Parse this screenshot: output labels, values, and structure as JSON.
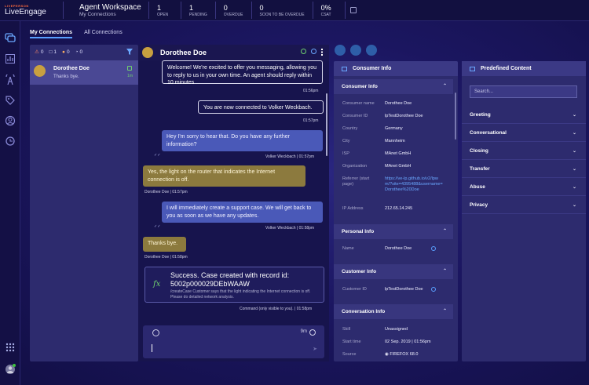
{
  "brand": {
    "small": "LIVEPERSON",
    "name": "LiveEngage"
  },
  "workspace": {
    "title": "Agent Workspace",
    "subtitle": "My Connections"
  },
  "stats": [
    {
      "value": "1",
      "label": "OPEN"
    },
    {
      "value": "1",
      "label": "PENDING"
    },
    {
      "value": "0",
      "label": "OVERDUE"
    },
    {
      "value": "0",
      "label": "SOON TO BE OVERDUE"
    },
    {
      "value": "0%",
      "label": "CSAT"
    }
  ],
  "tabs": {
    "active": "My Connections",
    "other": "All Connections"
  },
  "counts": [
    "0",
    "1",
    "0",
    "0"
  ],
  "conversation_item": {
    "name": "Dorothee Doe",
    "last_message": "Thanks bye.",
    "time": "1m"
  },
  "chat": {
    "header_name": "Dorothee Doe",
    "messages": [
      {
        "text": "Welcome! We're excited to offer you messaging, allowing you to reply to us in your own time. An agent should reply within 10 minutes",
        "meta": "01:56pm"
      },
      {
        "text": "You are now connected to Volker Weckbach.",
        "meta": "01:57pm"
      },
      {
        "text": "Hey I'm sorry to hear that. Do you have any further information?",
        "meta": "Volker Weckbach | 01:57pm"
      },
      {
        "text": "Yes, the light on the router that indicates the Internet connection is off.",
        "meta": "Dorothee Doe | 01:57pm"
      },
      {
        "text": "I will immediately create a support case. We will get back to you as soon as we have any updates.",
        "meta": "Volker Weckbach | 01:58pm"
      },
      {
        "text": "Thanks bye.",
        "meta": "Dorothee Doe | 01:58pm"
      }
    ],
    "success": {
      "title": "Success. Case created with record id: 5002p000029DEbWAAW",
      "detail": "/createCase Customer says that the light indicating the Internet connection is off. Please do detailed network analysis.",
      "meta": "Command (only visible to you). | 01:58pm"
    },
    "compose": {
      "timer": "9m"
    }
  },
  "consumer_info": {
    "title": "Consumer Info",
    "section1": "Consumer Info",
    "fields": [
      {
        "k": "Consumer name",
        "v": "Dorothee Doe"
      },
      {
        "k": "Consumer ID",
        "v": "lpTestDorothee Doe"
      },
      {
        "k": "Country",
        "v": "Germany"
      },
      {
        "k": "City",
        "v": "Mannheim"
      },
      {
        "k": "ISP",
        "v": "MAnet GmbH"
      },
      {
        "k": "Organization",
        "v": "MAnet GmbH"
      },
      {
        "k": "Referrer (start page)",
        "v": "https://ve-lp.github.io/v2/lpwm/?site=4395488&username=Dorothee%20Doe"
      },
      {
        "k": "IP Address",
        "v": "212.65.14.245"
      }
    ],
    "section2": "Personal Info",
    "personal": [
      {
        "k": "Name",
        "v": "Dorothee Doe"
      }
    ],
    "section3": "Customer Info",
    "customer": [
      {
        "k": "Customer ID",
        "v": "lpTestDorothee Doe"
      }
    ],
    "section4": "Conversation Info",
    "conversation": [
      {
        "k": "Skill",
        "v": "Unassigned"
      },
      {
        "k": "Start time",
        "v": "02 Sep. 2019 | 01:56pm"
      },
      {
        "k": "Source",
        "v": "FIREFOX 68.0"
      }
    ]
  },
  "predefined": {
    "title": "Predefined Content",
    "search_placeholder": "Search...",
    "items": [
      "Greeting",
      "Conversational",
      "Closing",
      "Transfer",
      "Abuse",
      "Privacy"
    ]
  }
}
